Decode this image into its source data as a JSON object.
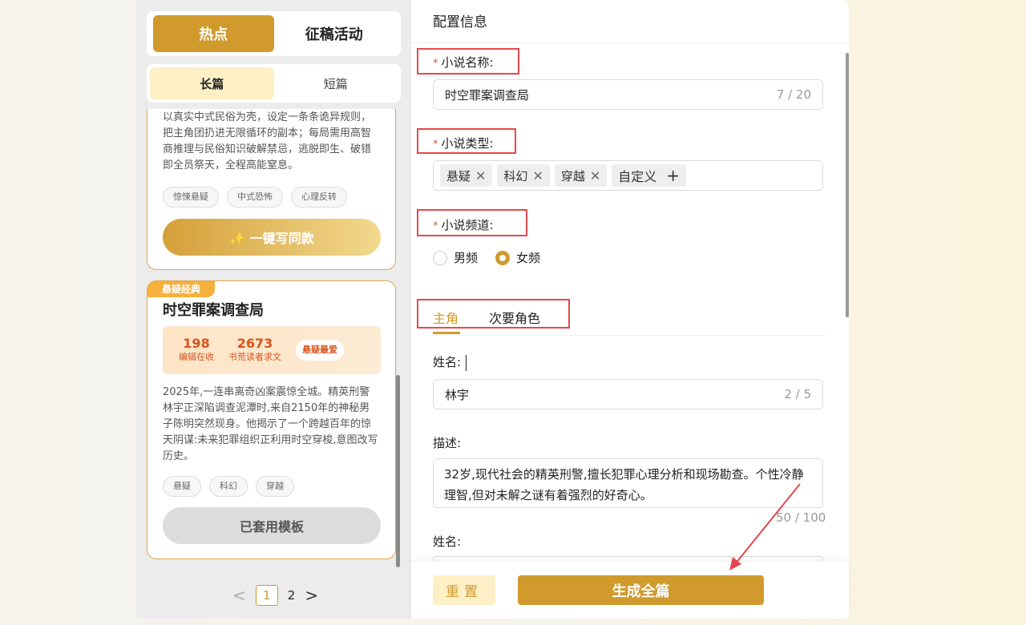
{
  "left": {
    "main_tabs": [
      "热点",
      "征稿活动"
    ],
    "sub_tabs": [
      "长篇",
      "短篇"
    ],
    "card1": {
      "desc": "以真实中式民俗为壳，设定一条条诡异规则，把主角团扔进无限循环的副本；每局需用高智商推理与民俗知识破解禁忌，逃脱即生、破错即全员祭天，全程高能窒息。",
      "tags": [
        "惊悚悬疑",
        "中式恐怖",
        "心理反转"
      ],
      "cta": "✨ 一键写同款"
    },
    "card2": {
      "badge": "悬疑经典",
      "title": "时空罪案调查局",
      "stat1_num": "198",
      "stat1_label": "编辑在收",
      "stat2_num": "2673",
      "stat2_label": "书荒读者求文",
      "stat_pill": "悬疑最爱",
      "desc": "2025年,一连串离奇凶案震惊全城。精英刑警林宇正深陷调查泥潭时,来自2150年的神秘男子陈明突然现身。他揭示了一个跨越百年的惊天阴谋:未来犯罪组织正利用时空穿梭,意图改写历史。",
      "tags": [
        "悬疑",
        "科幻",
        "穿越"
      ],
      "cta": "已套用模板"
    },
    "pager": {
      "prev": "<",
      "current": "1",
      "page2": "2",
      "next": ">"
    }
  },
  "right": {
    "header": "配置信息",
    "name_label": "小说名称:",
    "name_value": "时空罪案调查局",
    "name_count": "7 / 20",
    "type_label": "小说类型:",
    "type_chips": [
      "悬疑",
      "科幻",
      "穿越"
    ],
    "custom_chip": "自定义",
    "channel_label": "小说频道:",
    "channel_options": [
      "男频",
      "女频"
    ],
    "role_tabs": [
      "主角",
      "次要角色"
    ],
    "person_name_label": "姓名:",
    "person_name_value": "林宇",
    "person_name_count": "2 / 5",
    "desc_label": "描述:",
    "desc_value": "32岁,现代社会的精英刑警,擅长犯罪心理分析和现场勘查。个性冷静理智,但对未解之谜有着强烈的好奇心。",
    "desc_count": "50 / 100",
    "person2_label": "姓名:",
    "reset": "重置",
    "generate": "生成全篇"
  }
}
